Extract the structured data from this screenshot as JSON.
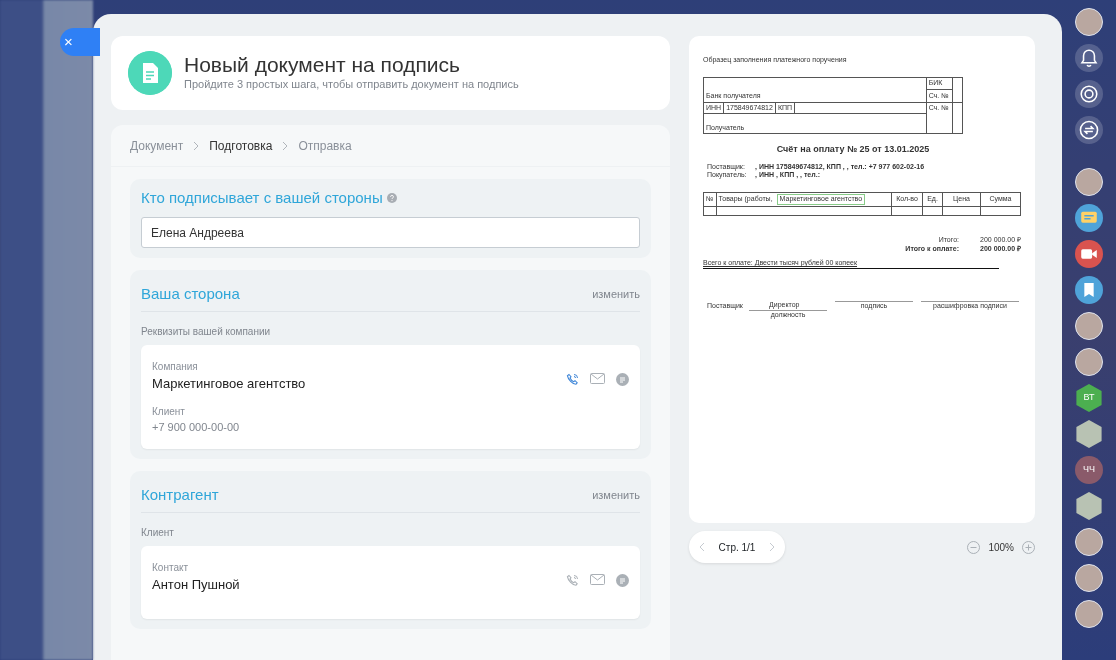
{
  "close_button": {
    "label": "×"
  },
  "header": {
    "title": "Новый документ на подпись",
    "subtitle": "Пройдите 3 простых шага, чтобы отправить документ на подпись"
  },
  "steps": [
    {
      "label": "Документ",
      "selected": false
    },
    {
      "label": "Подготовка",
      "selected": true
    },
    {
      "label": "Отправка",
      "selected": false
    }
  ],
  "signer": {
    "title": "Кто подписывает с вашей стороны",
    "value": "Елена Андреева"
  },
  "sections": [
    {
      "title": "Ваша сторона",
      "action": "изменить",
      "subtitle": "Реквизиты вашей компании",
      "call_active": true,
      "fields": [
        {
          "label": "Компания",
          "value": "Маркетинговое агентство",
          "kind": "name"
        },
        {
          "label": "Клиент",
          "value": "+7 900 000-00-00",
          "kind": "detail"
        }
      ]
    },
    {
      "title": "Контрагент",
      "action": "изменить",
      "subtitle": "Клиент",
      "call_active": false,
      "fields": [
        {
          "label": "Контакт",
          "value": "Антон Пушной",
          "kind": "name"
        }
      ]
    }
  ],
  "document": {
    "note": "Образец заполнения платежного поручения",
    "bank": {
      "bik": "БИК",
      "account": "Сч. №",
      "bank_name": "Банк получателя",
      "inn": "ИНН",
      "inn_value": "175849674812",
      "kpp": "КПП",
      "account2": "Сч. №",
      "recipient": "Получатель"
    },
    "title": "Счёт на оплату № 25 от 13.01.2025",
    "parties": [
      {
        "label": "Поставщик:",
        "value": ", ИНН 175849674812, КПП , , тел.: +7 977 602-02-16"
      },
      {
        "label": "Покупатель:",
        "value": ", ИНН , КПП , , тел.:"
      }
    ],
    "columns": [
      "№",
      "Товары (работы,",
      "Кол-во",
      "Ед.",
      "Цена",
      "Сумма"
    ],
    "stamp": "Маркетинговое агентство",
    "totals": [
      {
        "label": "Итого:",
        "value": "200 000.00 ₽",
        "bold": false
      },
      {
        "label": "Итого к оплате:",
        "value": "200 000.00 ₽",
        "bold": true
      }
    ],
    "total_words": "Всего к оплате: Двести тысяч рублей 00 копеек",
    "signature": {
      "role": "Поставщик",
      "position": "Директор",
      "captions": [
        "должность",
        "подпись",
        "расшифровка подписи"
      ]
    }
  },
  "pager": {
    "label": "Стр. 1/1",
    "zoom": "100%"
  },
  "right_sidebar": [
    {
      "kind": "user"
    },
    {
      "kind": "bell"
    },
    {
      "kind": "target"
    },
    {
      "kind": "swap"
    },
    {
      "kind": "user"
    },
    {
      "kind": "chat",
      "color": "#4fa3d9"
    },
    {
      "kind": "video",
      "color": "#d9534f"
    },
    {
      "kind": "bookmark",
      "color": "#4fa3d9"
    },
    {
      "kind": "user"
    },
    {
      "kind": "user"
    },
    {
      "kind": "badge",
      "text": "ВТ",
      "color": "#4caf50"
    },
    {
      "kind": "group"
    },
    {
      "kind": "initials",
      "text": "ЧЧ",
      "color": "#8a5a6a"
    },
    {
      "kind": "group"
    },
    {
      "kind": "user"
    },
    {
      "kind": "user"
    },
    {
      "kind": "user"
    }
  ]
}
